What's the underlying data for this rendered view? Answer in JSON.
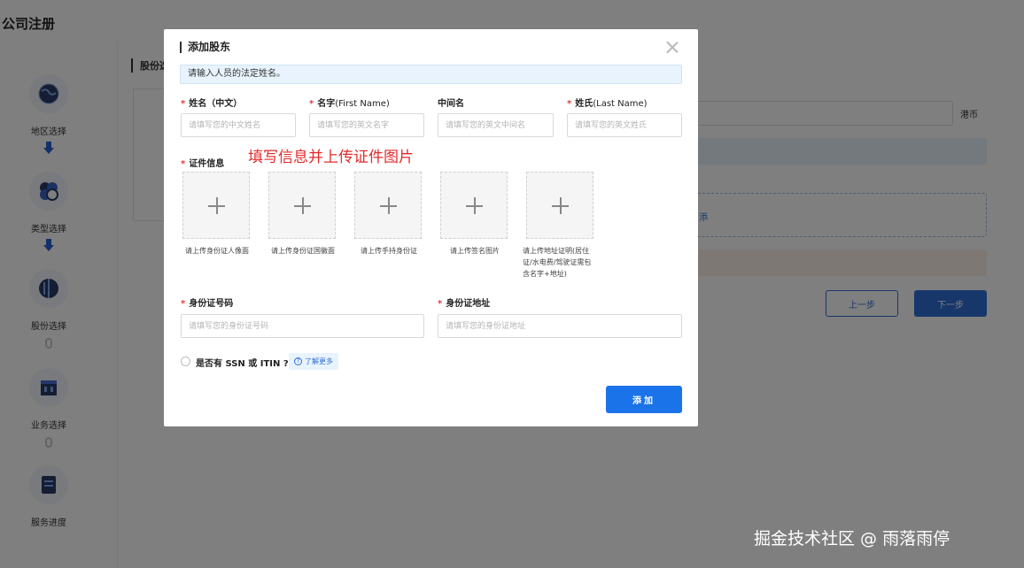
{
  "page": {
    "title": "公司注册",
    "section_title": "股份选",
    "currency": "港币",
    "prev_button": "上一步",
    "next_button": "下一步",
    "dashed_hint": "添"
  },
  "steps": [
    {
      "label": "地区选择",
      "icon": "globe-icon"
    },
    {
      "label": "类型选择",
      "icon": "hexagons-icon"
    },
    {
      "label": "股份选择",
      "icon": "pie-chart-icon"
    },
    {
      "label": "业务选择",
      "icon": "building-icon"
    },
    {
      "label": "服务进度",
      "icon": "document-icon"
    }
  ],
  "modal": {
    "title": "添加股东",
    "tip": "请输入人员的法定姓名。",
    "annotation": "填写信息并上传证件图片",
    "fields": {
      "cn_name": {
        "label": "姓名（中文）",
        "placeholder": "请填写您的中文姓名",
        "required": "*"
      },
      "first_name": {
        "label": "名字",
        "label_en": "(First Name)",
        "placeholder": "请填写您的英文名字",
        "required": "*"
      },
      "middle_name": {
        "label": "中间名",
        "placeholder": "请填写您的英文中间名"
      },
      "last_name": {
        "label": "姓氏",
        "label_en": "(Last Name)",
        "placeholder": "请填写您的英文姓氏",
        "required": "*"
      },
      "id_number": {
        "label": "身份证号码",
        "placeholder": "请填写您的身份证号码",
        "required": "*"
      },
      "id_address": {
        "label": "身份证地址",
        "placeholder": "请填写您的身份证地址",
        "required": "*"
      }
    },
    "documents": {
      "label": "证件信息",
      "required": "*",
      "uploads": [
        {
          "caption": "请上传身份证人像面"
        },
        {
          "caption": "请上传身份证国徽面"
        },
        {
          "caption": "请上传手持身份证"
        },
        {
          "caption": "请上传签名图片"
        },
        {
          "caption": "请上传地址证明(居住证/水电费/驾驶证需包含名字+地址)"
        }
      ]
    },
    "ssn": {
      "label": "是否有 SSN 或 ITIN ?",
      "learn_more": "了解更多",
      "learn_more_icon": "?"
    },
    "add_button": "添加"
  },
  "watermark": "掘金技术社区 @ 雨落雨停",
  "colors": {
    "primary": "#1a73e8",
    "required": "#e23b3b",
    "annotation": "#e02b2b",
    "tip_bg": "#e8f3fd"
  }
}
